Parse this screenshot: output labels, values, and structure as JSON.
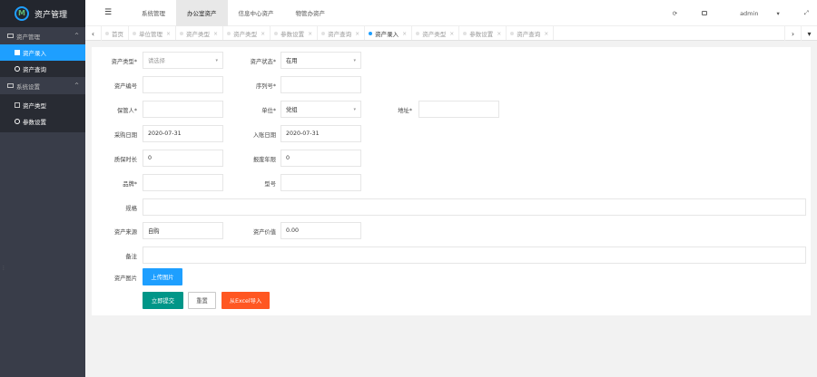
{
  "app": {
    "title": "资产管理"
  },
  "sidebar": {
    "groups": [
      {
        "label": "资产管理",
        "items": [
          {
            "label": "资产录入"
          },
          {
            "label": "资产查询"
          }
        ]
      },
      {
        "label": "系统设置",
        "items": [
          {
            "label": "资产类型"
          },
          {
            "label": "参数设置"
          }
        ]
      }
    ]
  },
  "topnav": {
    "toggle_icon": "☰",
    "items": [
      "系统管理",
      "办公室资产",
      "信息中心资产",
      "物管办资产"
    ]
  },
  "header": {
    "refresh_icon": "⟳",
    "user": "admin",
    "user_caret": "▾",
    "fullscreen_icon": "⤢"
  },
  "tabs": {
    "prev": "‹",
    "next": "›",
    "close": "×",
    "items": [
      "首页",
      "单位管理",
      "资产类型",
      "资产类型",
      "参数设置",
      "资产查询",
      "资产录入",
      "资产类型",
      "参数设置",
      "资产查询"
    ]
  },
  "form": {
    "select_caret": "▾",
    "asset_type": {
      "label": "资产类型*",
      "placeholder": "请选择"
    },
    "asset_status": {
      "label": "资产状态*",
      "value": "在用"
    },
    "asset_no": {
      "label": "资产编号",
      "value": ""
    },
    "serial_no": {
      "label": "序列号*",
      "value": ""
    },
    "custodian": {
      "label": "保管人*",
      "value": ""
    },
    "unit": {
      "label": "单位*",
      "value": "党组"
    },
    "address": {
      "label": "地址*",
      "value": ""
    },
    "purchase_date": {
      "label": "采购日期",
      "value": "2020-07-31"
    },
    "entry_date": {
      "label": "入账日期",
      "value": "2020-07-31"
    },
    "warranty": {
      "label": "质保时长",
      "value": "0"
    },
    "scrap_years": {
      "label": "报废年限",
      "value": "0"
    },
    "brand": {
      "label": "品牌*",
      "value": ""
    },
    "model": {
      "label": "型号",
      "value": ""
    },
    "spec": {
      "label": "规格",
      "value": ""
    },
    "source": {
      "label": "资产来源",
      "value": "自购"
    },
    "price": {
      "label": "资产价值",
      "value": "0.00"
    },
    "remark": {
      "label": "备注",
      "value": ""
    },
    "image": {
      "label": "资产图片",
      "button": "上传图片"
    },
    "actions": {
      "submit": "立即提交",
      "reset": "重置",
      "import": "从Excel导入"
    }
  }
}
